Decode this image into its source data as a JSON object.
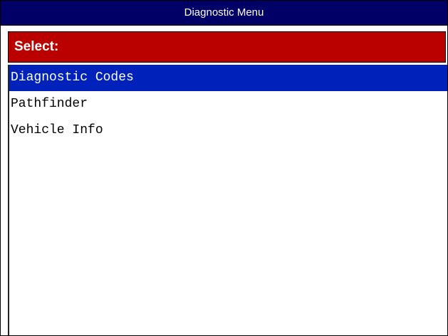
{
  "window": {
    "title": "Diagnostic Menu"
  },
  "header": {
    "label": "Select:"
  },
  "menu": {
    "selected_index": 0,
    "items": [
      {
        "label": "Diagnostic Codes"
      },
      {
        "label": "Pathfinder"
      },
      {
        "label": "Vehicle Info"
      }
    ]
  },
  "colors": {
    "title_bar": "#000066",
    "header": "#bb0000",
    "selection": "#0022bb"
  }
}
